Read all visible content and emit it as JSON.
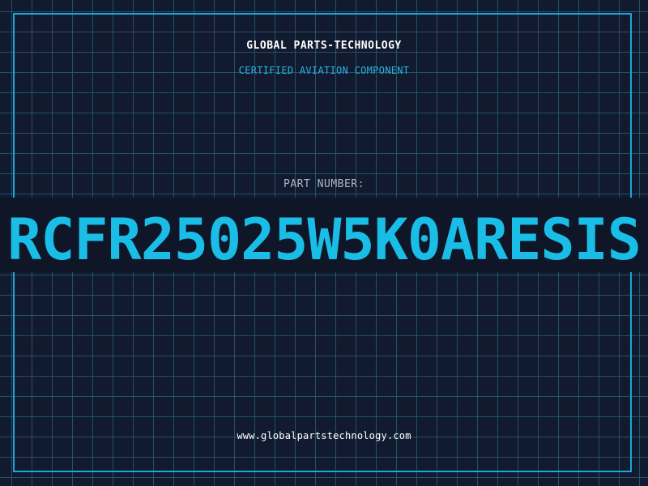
{
  "header": {
    "company": "GLOBAL PARTS-TECHNOLOGY",
    "subtitle": "CERTIFIED AVIATION COMPONENT"
  },
  "part": {
    "label": "PART NUMBER:",
    "value": "RCFR25025W5K0ARESIS"
  },
  "footer": {
    "url": "www.globalpartstechnology.com"
  },
  "colors": {
    "background": "#111a2e",
    "grid": "#2a627a",
    "accent": "#19a9d6",
    "text": "#ffffff"
  }
}
